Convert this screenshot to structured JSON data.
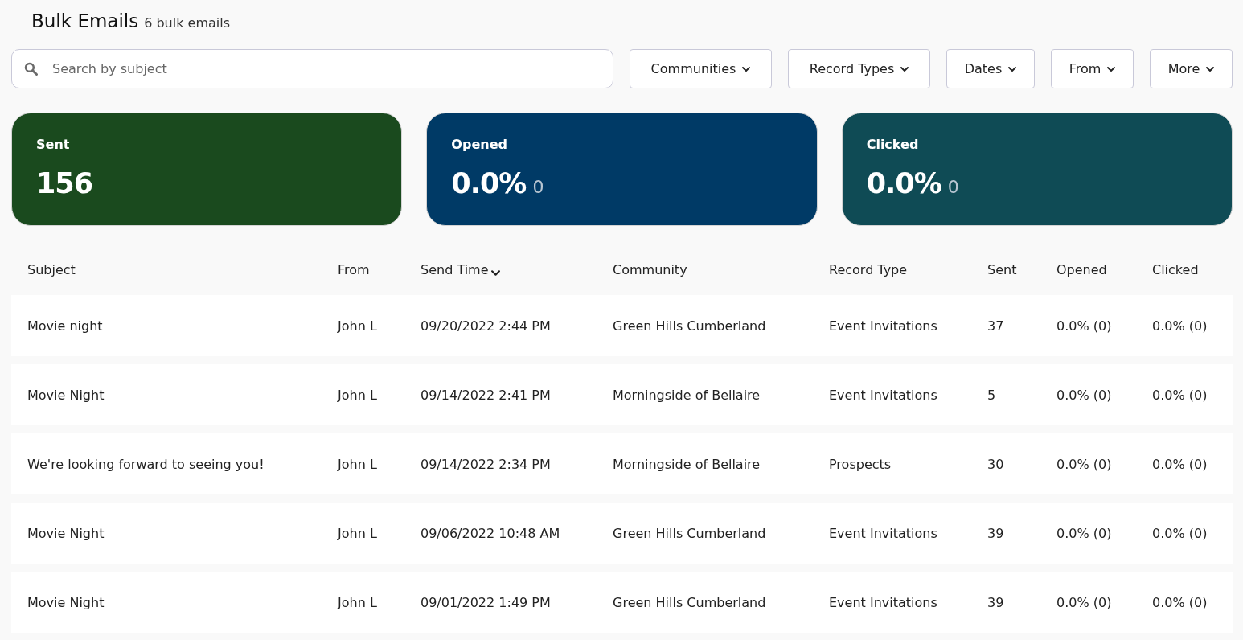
{
  "header": {
    "title": "Bulk Emails",
    "subtitle": "6 bulk emails"
  },
  "search": {
    "placeholder": "Search by subject"
  },
  "filters": [
    {
      "label": "Communities"
    },
    {
      "label": "Record Types"
    },
    {
      "label": "Dates"
    },
    {
      "label": "From"
    },
    {
      "label": "More"
    }
  ],
  "stats": [
    {
      "label": "Sent",
      "value": "156",
      "color": "#1a4a1e"
    },
    {
      "label": "Opened",
      "value": "0.0%",
      "count": "0",
      "color": "#003a66"
    },
    {
      "label": "Clicked",
      "value": "0.0%",
      "count": "0",
      "color": "#0f4b55"
    }
  ],
  "table": {
    "columns": [
      {
        "label": "Subject",
        "sorted": false
      },
      {
        "label": "From",
        "sorted": false
      },
      {
        "label": "Send Time",
        "sorted": true
      },
      {
        "label": "Community",
        "sorted": false
      },
      {
        "label": "Record Type",
        "sorted": false
      },
      {
        "label": "Sent",
        "sorted": false
      },
      {
        "label": "Opened",
        "sorted": false
      },
      {
        "label": "Clicked",
        "sorted": false
      }
    ],
    "rows": [
      [
        "Movie night",
        "John L",
        "09/20/2022 2:44 PM",
        "Green Hills Cumberland",
        "Event Invitations",
        "37",
        "0.0% (0)",
        "0.0% (0)"
      ],
      [
        "Movie Night",
        "John L",
        "09/14/2022 2:41 PM",
        "Morningside of Bellaire",
        "Event Invitations",
        "5",
        "0.0% (0)",
        "0.0% (0)"
      ],
      [
        "We're looking forward to seeing you!",
        "John L",
        "09/14/2022 2:34 PM",
        "Morningside of Bellaire",
        "Prospects",
        "30",
        "0.0% (0)",
        "0.0% (0)"
      ],
      [
        "Movie Night",
        "John L",
        "09/06/2022 10:48 AM",
        "Green Hills Cumberland",
        "Event Invitations",
        "39",
        "0.0% (0)",
        "0.0% (0)"
      ],
      [
        "Movie Night",
        "John L",
        "09/01/2022 1:49 PM",
        "Green Hills Cumberland",
        "Event Invitations",
        "39",
        "0.0% (0)",
        "0.0% (0)"
      ]
    ]
  }
}
